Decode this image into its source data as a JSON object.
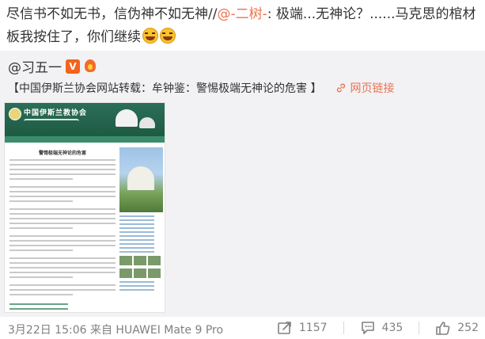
{
  "post": {
    "text_part1": "尽信书不如无书，信伪神不如无神//",
    "mention": "@-二树-",
    "text_part2": ": 极端...无神论？......马克思的棺材板我按住了，你们继续",
    "emoji_name": "laugh-cry-emoji"
  },
  "repost": {
    "author": "@习五一",
    "vip_badge": "V",
    "fire_badge_icon": "fire-badge-icon",
    "text": "【中国伊斯兰协会网站转载：牟钟鉴：警惕极端无神论的危害 】",
    "link_label": "网页链接",
    "thumbnail": {
      "site_title": "中国伊斯兰教协会",
      "article_title": "警惕极端无神论的危害"
    }
  },
  "footer": {
    "meta": "3月22日 15:06 来自 HUAWEI Mate 9 Pro",
    "repost_count": "1157",
    "comment_count": "435",
    "like_count": "252"
  },
  "colors": {
    "accent": "#eb7350",
    "repost_bg": "#f2f2f5",
    "meta_text": "#808080"
  }
}
